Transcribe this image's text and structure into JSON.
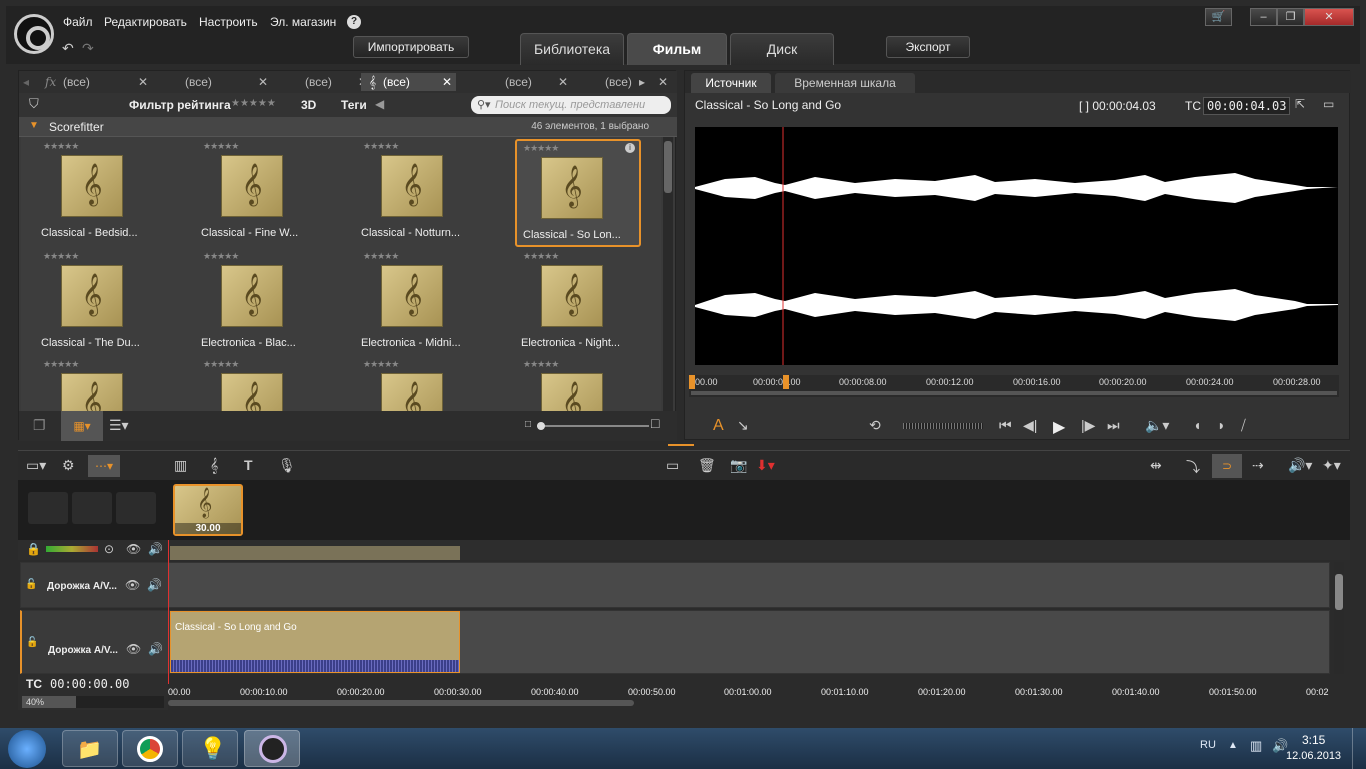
{
  "menu": {
    "file": "Файл",
    "edit": "Редактировать",
    "settings": "Настроить",
    "store": "Эл. магазин",
    "help": "?"
  },
  "top": {
    "import": "Импортировать",
    "export": "Экспорт",
    "tabs": [
      "Библиотека",
      "Фильм",
      "Диск"
    ]
  },
  "filter_tabs": [
    "(все)",
    "(все)",
    "(все)",
    "(все)",
    "(все)",
    "(все)"
  ],
  "library": {
    "rating_filter": "Фильтр рейтинга",
    "stars": "★★★★★",
    "three_d": "3D",
    "tags": "Теги",
    "search_placeholder": "Поиск текущ. представлени",
    "group": "Scorefitter",
    "count": "46 элементов, 1 выбрано"
  },
  "items": [
    "Classical - Bedsid...",
    "Classical - Fine W...",
    "Classical - Notturn...",
    "Classical - So Lon...",
    "Classical - The Du...",
    "Electronica - Blac...",
    "Electronica - Midni...",
    "Electronica - Night...",
    "",
    "",
    "",
    ""
  ],
  "player": {
    "tab_source": "Источник",
    "tab_timeline": "Временная шкала",
    "title": "Classical - So Long and Go",
    "duration": "[ ] 00:00:04.03",
    "tc_label": "TC",
    "tc_value": "00:00:04.03",
    "ruler": [
      "00.00",
      "00:00:04.00",
      "00:00:08.00",
      "00:00:12.00",
      "00:00:16.00",
      "00:00:20.00",
      "00:00:24.00",
      "00:00:28.00"
    ]
  },
  "timeline": {
    "clip_duration": "30.00",
    "track1": "Дорожка A/V...",
    "track2": "Дорожка A/V...",
    "clip_title": "Classical - So Long and Go",
    "tc_label": "TC",
    "tc_value": "00:00:00.00",
    "zoom": "40%",
    "ruler": [
      "00.00",
      "00:00:10.00",
      "00:00:20.00",
      "00:00:30.00",
      "00:00:40.00",
      "00:00:50.00",
      "00:01:00.00",
      "00:01:10.00",
      "00:01:20.00",
      "00:01:30.00",
      "00:01:40.00",
      "00:01:50.00",
      "00:02"
    ]
  },
  "taskbar": {
    "lang": "RU",
    "time": "3:15",
    "date": "12.06.2013"
  },
  "colors": {
    "accent": "#e8922a",
    "clip": "#b5a472"
  }
}
